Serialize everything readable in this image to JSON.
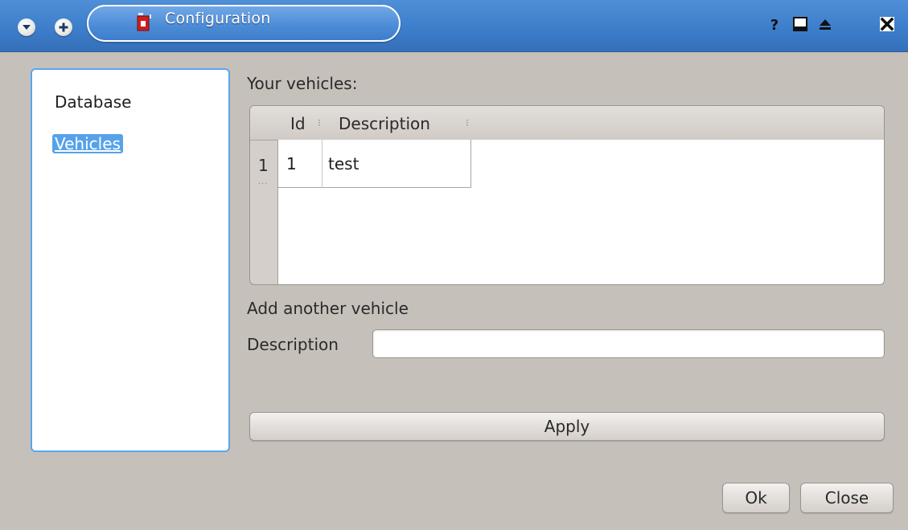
{
  "window": {
    "title": "Configuration",
    "colors": {
      "titlebar": "#3d7ecb",
      "selection": "#56a2ea",
      "background": "#c6c0bb"
    },
    "titlebar_buttons": {
      "menu_icon": "chevron-down-icon",
      "new_icon": "plus-icon",
      "help_icon": "help-icon",
      "minimize_icon": "minimize-icon",
      "maximize_icon": "maximize-icon",
      "close_icon": "close-icon"
    }
  },
  "sidebar": {
    "items": [
      {
        "label": "Database",
        "selected": false
      },
      {
        "label": "Vehicles",
        "selected": true
      }
    ]
  },
  "vehicles": {
    "heading": "Your vehicles:",
    "table": {
      "columns": [
        "Id",
        "Description"
      ],
      "rows": [
        {
          "row_number": "1",
          "id": "1",
          "description": "test"
        }
      ]
    }
  },
  "add_vehicle": {
    "heading": "Add another vehicle",
    "description_label": "Description",
    "description_value": "",
    "apply_label": "Apply"
  },
  "footer": {
    "ok_label": "Ok",
    "close_label": "Close"
  }
}
